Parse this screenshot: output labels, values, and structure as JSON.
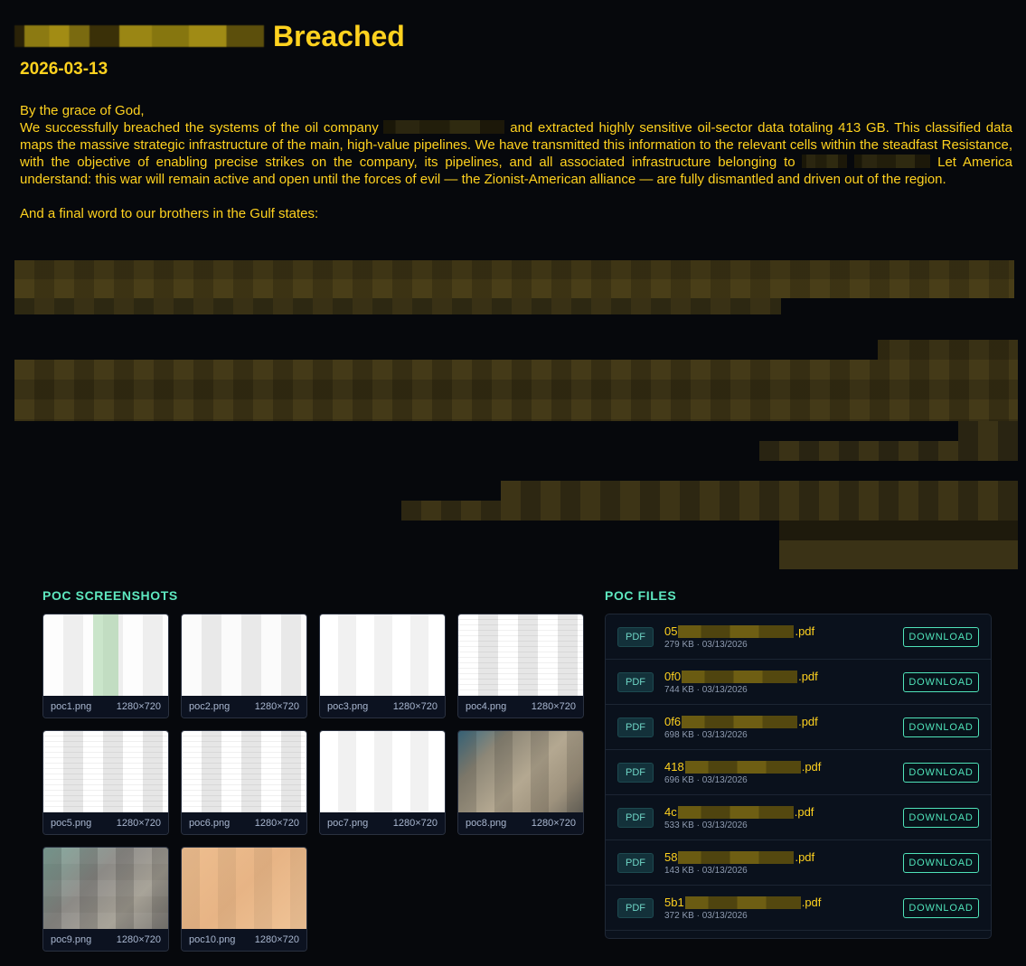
{
  "header": {
    "title_suffix": "Breached",
    "date": "2026-03-13"
  },
  "message": {
    "greeting": "By the grace of God,",
    "p1_part1": "We successfully breached the systems of the oil company ",
    "p1_part2": " and extracted highly sensitive oil-sector data totaling 413 GB. This classified data maps the massive strategic infrastructure of the main, high-value pipelines. We have transmitted this information to the relevant cells within the steadfast Resistance, with the objective of enabling precise strikes on the company, its pipelines, and all associated infrastructure belonging to ",
    "p1_part3": " Let America understand: this war will remain active and open until the forces of evil — the Zionist-American alliance — are fully dismantled and driven out of the region.",
    "final_word": "And a final word to our brothers in the Gulf states:"
  },
  "sections": {
    "screenshots_title": "POC SCREENSHOTS",
    "files_title": "POC FILES"
  },
  "screenshots": [
    {
      "name": "poc1.png",
      "size": "1280×720"
    },
    {
      "name": "poc2.png",
      "size": "1280×720"
    },
    {
      "name": "poc3.png",
      "size": "1280×720"
    },
    {
      "name": "poc4.png",
      "size": "1280×720"
    },
    {
      "name": "poc5.png",
      "size": "1280×720"
    },
    {
      "name": "poc6.png",
      "size": "1280×720"
    },
    {
      "name": "poc7.png",
      "size": "1280×720"
    },
    {
      "name": "poc8.png",
      "size": "1280×720"
    },
    {
      "name": "poc9.png",
      "size": "1280×720"
    },
    {
      "name": "poc10.png",
      "size": "1280×720"
    }
  ],
  "files": [
    {
      "badge": "PDF",
      "prefix": "05",
      "suffix": ".pdf",
      "meta": "279 KB · 03/13/2026",
      "button": "DOWNLOAD"
    },
    {
      "badge": "PDF",
      "prefix": "0f0",
      "suffix": ".pdf",
      "meta": "744 KB · 03/13/2026",
      "button": "DOWNLOAD"
    },
    {
      "badge": "PDF",
      "prefix": "0f6",
      "suffix": ".pdf",
      "meta": "698 KB · 03/13/2026",
      "button": "DOWNLOAD"
    },
    {
      "badge": "PDF",
      "prefix": "418",
      "suffix": ".pdf",
      "meta": "696 KB · 03/13/2026",
      "button": "DOWNLOAD"
    },
    {
      "badge": "PDF",
      "prefix": "4c",
      "suffix": ".pdf",
      "meta": "533 KB · 03/13/2026",
      "button": "DOWNLOAD"
    },
    {
      "badge": "PDF",
      "prefix": "58",
      "suffix": ".pdf",
      "meta": "143 KB · 03/13/2026",
      "button": "DOWNLOAD"
    },
    {
      "badge": "PDF",
      "prefix": "5b1",
      "suffix": ".pdf",
      "meta": "372 KB · 03/13/2026",
      "button": "DOWNLOAD"
    }
  ],
  "colors": {
    "background": "#06080c",
    "text_yellow": "#ffd21f",
    "accent_teal": "#4fe3b9",
    "section_title": "#5ee8c0"
  },
  "icons": {
    "file_badge": "pdf-badge-icon"
  }
}
